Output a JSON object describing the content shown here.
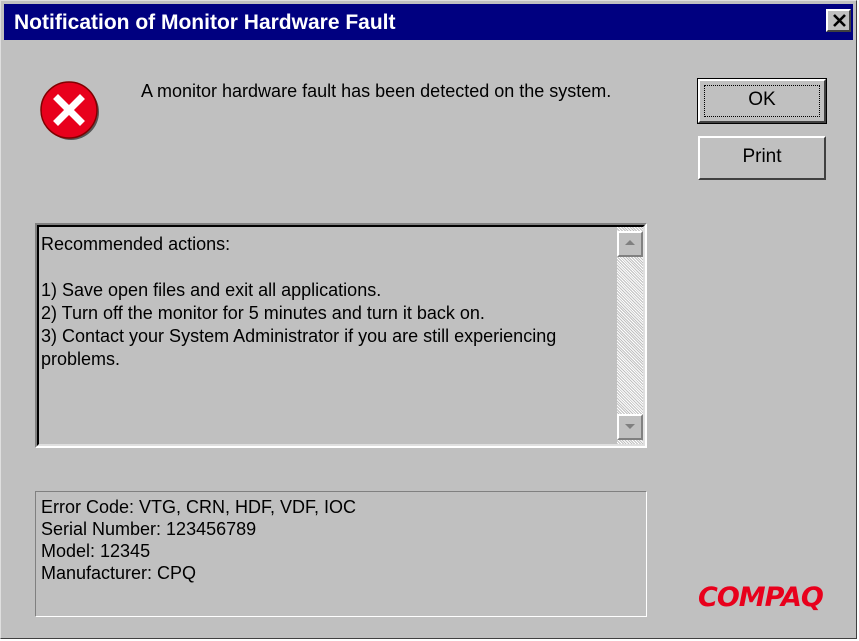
{
  "window": {
    "title": "Notification of Monitor Hardware Fault",
    "close_icon": "close-icon"
  },
  "message": {
    "icon": "error-icon",
    "icon_color": "#e8001c",
    "text": "A monitor hardware fault has been detected on the system."
  },
  "buttons": {
    "ok_label": "OK",
    "print_label": "Print"
  },
  "actions": {
    "heading": "Recommended actions:",
    "items": [
      "1) Save open files and exit all applications.",
      "2) Turn off the monitor for 5 minutes and turn it back on.",
      "3) Contact your System Administrator if you are still experiencing problems."
    ]
  },
  "details": {
    "error_code": "Error Code: VTG, CRN, HDF, VDF, IOC",
    "serial_number": "Serial Number: 123456789",
    "model": "Model: 12345",
    "manufacturer": "Manufacturer: CPQ"
  },
  "brand": {
    "logo_text": "COMPAQ",
    "color": "#e8001c"
  },
  "colors": {
    "title_bar": "#000080",
    "window_face": "#c0c0c0"
  }
}
